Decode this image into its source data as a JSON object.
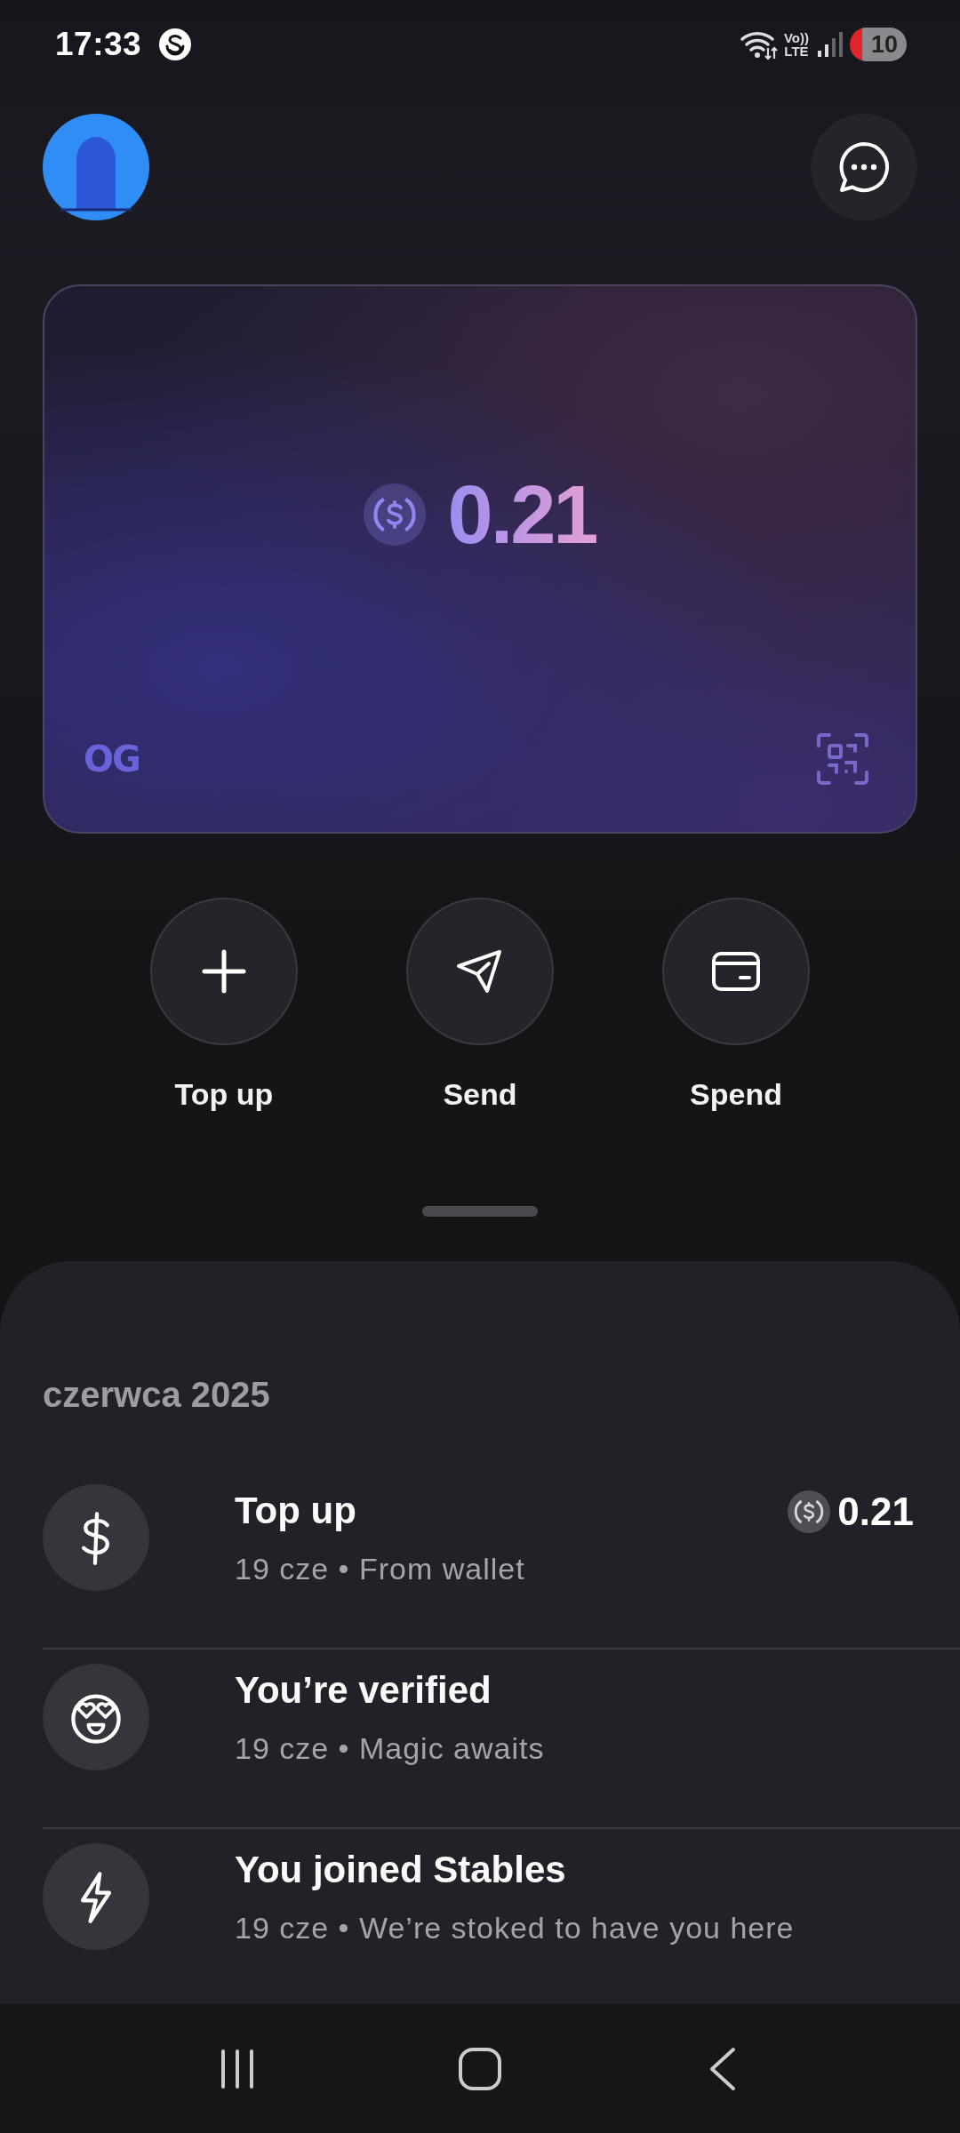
{
  "status_bar": {
    "time": "17:33",
    "network_top": "Vo))",
    "network_bottom": "LTE",
    "battery": "10"
  },
  "card": {
    "balance": "0.21",
    "badge": "OG"
  },
  "actions": [
    {
      "kind": "plus",
      "label": "Top up"
    },
    {
      "kind": "send",
      "label": "Send"
    },
    {
      "kind": "card",
      "label": "Spend"
    }
  ],
  "activity": {
    "month": "czerwca 2025",
    "items": [
      {
        "kind": "dollar",
        "title": "Top up",
        "subtitle": "19 cze • From wallet",
        "amount": "0.21"
      },
      {
        "kind": "smile",
        "title": "You’re verified",
        "subtitle": "19 cze • Magic awaits"
      },
      {
        "kind": "bolt",
        "title": "You joined Stables",
        "subtitle": "19 cze • We’re stoked to have you here"
      }
    ]
  }
}
